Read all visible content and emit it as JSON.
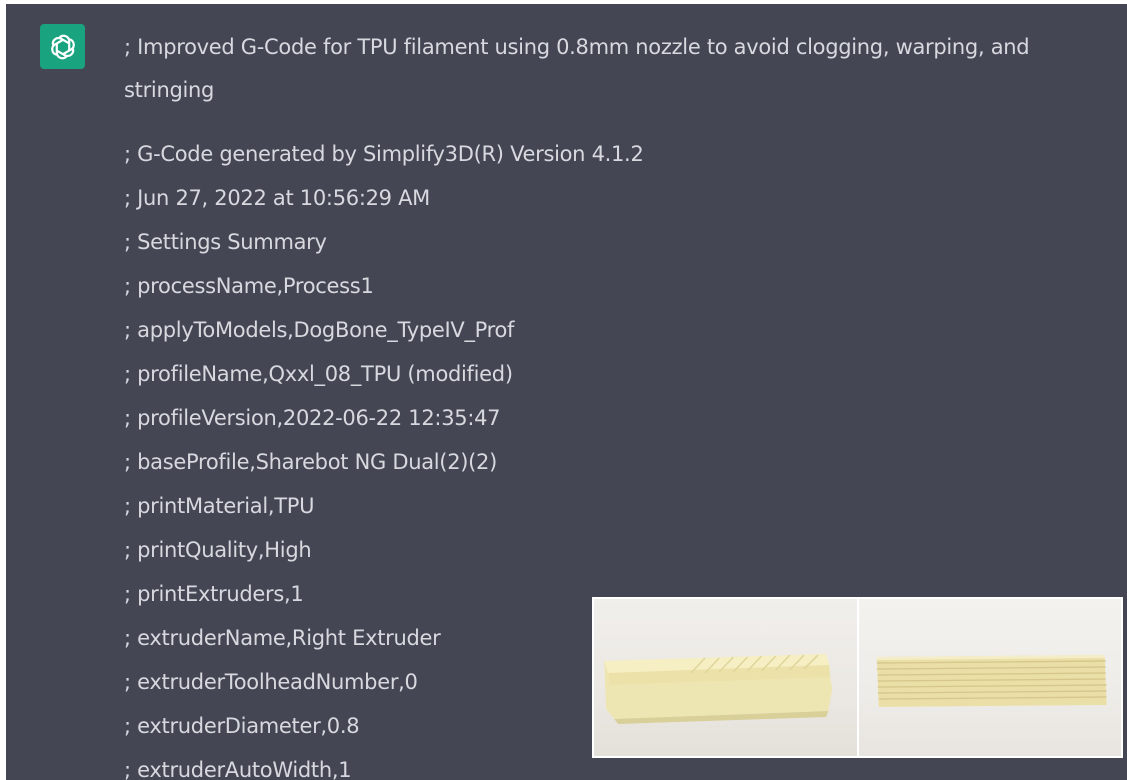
{
  "assistant": {
    "avatar_icon": "openai-logo-icon",
    "avatar_color": "#19a37f"
  },
  "message": {
    "intro": "; Improved G-Code for TPU filament using 0.8mm nozzle to avoid clogging, warping, and stringing",
    "lines": [
      "; G-Code generated by Simplify3D(R) Version 4.1.2",
      "; Jun 27, 2022 at 10:56:29 AM",
      "; Settings Summary",
      "; processName,Process1",
      "; applyToModels,DogBone_TypeIV_Prof",
      "; profileName,Qxxl_08_TPU (modified)",
      "; profileVersion,2022-06-22 12:35:47",
      "; baseProfile,Sharebot NG Dual(2)(2)",
      "; printMaterial,TPU",
      "; printQuality,High",
      "; printExtruders,1",
      "; extruderName,Right Extruder",
      "; extruderToolheadNumber,0",
      "; extruderDiameter,0.8",
      "; extruderAutoWidth,1"
    ]
  },
  "colors": {
    "panel_background": "#444654",
    "text": "#d7d9df"
  }
}
